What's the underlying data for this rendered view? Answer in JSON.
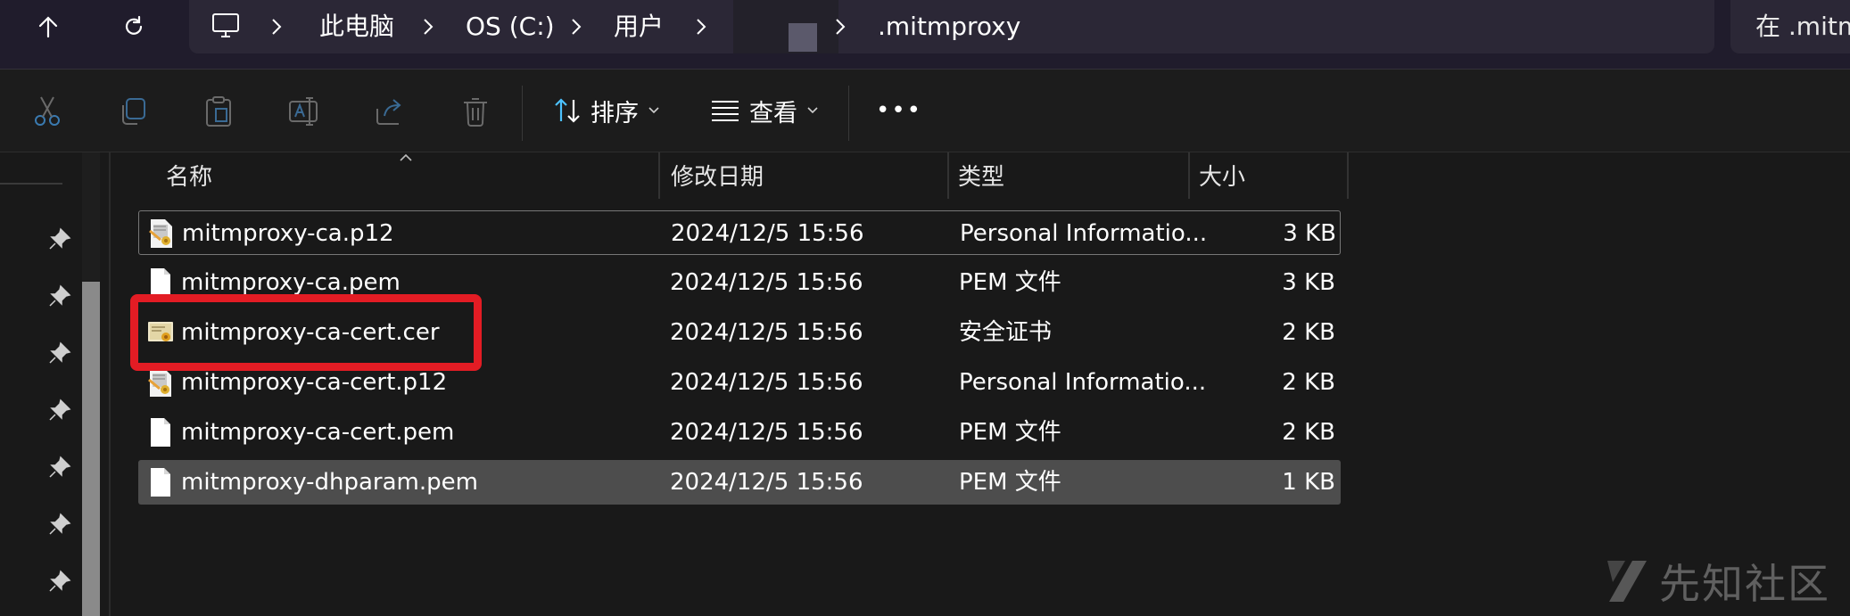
{
  "address_bar": {
    "crumbs": [
      "此电脑",
      "OS (C:)",
      "用户",
      ".mitmproxy"
    ],
    "search_placeholder": "在 .mitm"
  },
  "toolbar": {
    "sort_label": "排序",
    "view_label": "查看",
    "more_label": "•••"
  },
  "columns": {
    "name": "名称",
    "modified": "修改日期",
    "type": "类型",
    "size": "大小"
  },
  "files": [
    {
      "name": "mitmproxy-ca.p12",
      "modified": "2024/12/5 15:56",
      "type": "Personal Informatio...",
      "size": "3 KB",
      "icon": "pfx-certificate-icon"
    },
    {
      "name": "mitmproxy-ca.pem",
      "modified": "2024/12/5 15:56",
      "type": "PEM 文件",
      "size": "3 KB",
      "icon": "blank-file-icon"
    },
    {
      "name": "mitmproxy-ca-cert.cer",
      "modified": "2024/12/5 15:56",
      "type": "安全证书",
      "size": "2 KB",
      "icon": "security-certificate-icon"
    },
    {
      "name": "mitmproxy-ca-cert.p12",
      "modified": "2024/12/5 15:56",
      "type": "Personal Informatio...",
      "size": "2 KB",
      "icon": "pfx-certificate-icon"
    },
    {
      "name": "mitmproxy-ca-cert.pem",
      "modified": "2024/12/5 15:56",
      "type": "PEM 文件",
      "size": "2 KB",
      "icon": "blank-file-icon"
    },
    {
      "name": "mitmproxy-dhparam.pem",
      "modified": "2024/12/5 15:56",
      "type": "PEM 文件",
      "size": "1 KB",
      "icon": "blank-file-icon"
    }
  ],
  "watermark": "先知社区",
  "colors": {
    "annotation_red": "#e31c24",
    "selection_fill": "#4d4d4d",
    "accent_blue": "#4cc2ff"
  }
}
